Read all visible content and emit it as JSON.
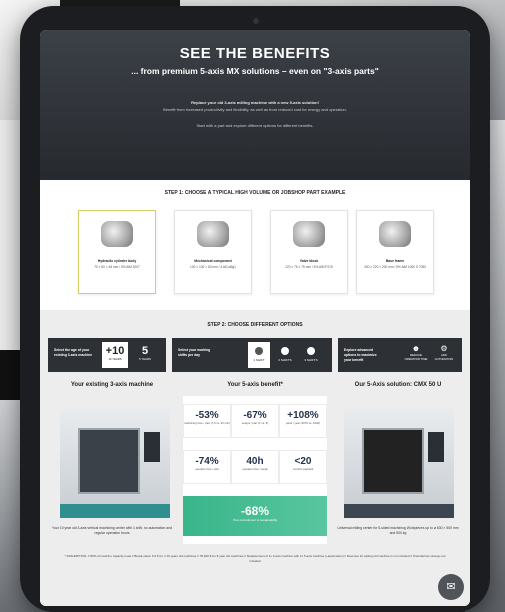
{
  "hero": {
    "title": "SEE THE BENEFITS",
    "subtitle": "... from premium 5-axis MX solutions – even on \"3-axis parts\"",
    "para1": "Replace your old 3-axis milling machine with a new 5-axis solution!",
    "para2": "Benefit from increased productivity and flexibility, as well as from reduced cost for energy and operation.",
    "para3": "Start with a part and explore different options for different benefits."
  },
  "step1": {
    "title": "STEP 1: CHOOSE A TYPICAL HIGH VOLUME OR JOBSHOP PART EXAMPLE",
    "parts": [
      {
        "name": "Hydraulic cylinder body",
        "dims": "70 × 60 × 46 mm / 5% AlM 2007"
      },
      {
        "name": "Mechanical component",
        "dims": "100 × 100 × 63 mm / 4 AlCuMg1"
      },
      {
        "name": "Valve block",
        "dims": "120 × 76 × 75 mm / 5% AlM P276"
      },
      {
        "name": "Base frame",
        "dims": "300 × 220 × 200 mm / 5% AlM 1060 S 7050"
      }
    ]
  },
  "step2": {
    "title": "STEP 2: CHOOSE DIFFERENT OPTIONS",
    "age_label": "Select the age of your existing 3-axis machine",
    "age_options": [
      {
        "value": "+10",
        "unit": "10 YEARS"
      },
      {
        "value": "5",
        "unit": "5 YEARS"
      }
    ],
    "shift_label": "Select your working shifts per day",
    "shifts": [
      "1 SHIFT",
      "2 SHIFTS",
      "3 SHIFTS"
    ],
    "adv_label": "Explore advanced options to maximize your benefit",
    "adv_options": [
      "REDUCE OPERATOR TIME",
      "ADD AUTOMATION"
    ]
  },
  "existing": {
    "title": "Your existing 3-axis machine",
    "caption": "Your 10 year old 3-axis vertical machining center with 1 shift, no automation and regular operation hours"
  },
  "benefits": {
    "title": "Your 5-axis benefit*",
    "tiles": [
      {
        "value": "-53%",
        "unit": "machining time / part (7.9 vs. 32 min)"
      },
      {
        "value": "-67%",
        "unit": "setups / part (1 vs. 3)"
      },
      {
        "value": "+108%",
        "unit": "parts / year (2076 vs. 1000)"
      },
      {
        "value": "-74%",
        "unit": "operator time / part"
      },
      {
        "value": "40h",
        "unit": "operator time / week"
      },
      {
        "value": "<20",
        "unit": "months payback"
      }
    ],
    "co2_value": "-68%",
    "co2_unit": "Your commitment to sustainability"
  },
  "solution": {
    "title": "Our 5-Axis solution: CMX 50 U",
    "caption": "Universal milling center for 5-sided machining Workpieces up to ø 630 × 500 mm and 500 kg"
  },
  "footnote": "* ASSUMPTION: // 80% of machine capacity used // Break-value: 5.6 € for // 10 years old machines // 78,000 € for 5-year old machines // Replacement of 1x 3-axis machine with 1x 5-axis machine (+automation) // Revenue for selling old machine is not included // Potential tax savings not included",
  "chat_icon": "chat-icon",
  "colors": {
    "accent_green": "#39b58a",
    "hero_bg": "#2f3338",
    "highlight": "#d3d065"
  }
}
